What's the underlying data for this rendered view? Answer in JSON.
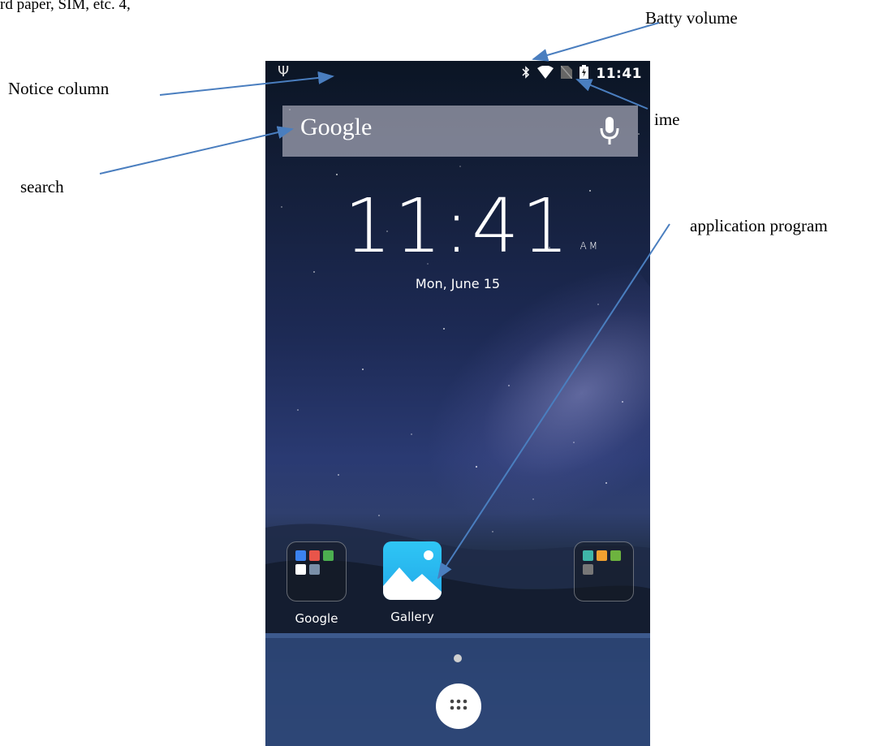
{
  "annotations": {
    "cutoff": "rd paper, SIM, etc. 4,",
    "batty_volume": "Batty volume",
    "notice_column": "Notice column",
    "time": "ime",
    "search": "search",
    "application_program": "application program"
  },
  "status_bar": {
    "left_icon": "usb-icon",
    "icons": [
      "bluetooth-icon",
      "wifi-icon",
      "no-sim-icon",
      "battery-charging-icon"
    ],
    "time": "11:41"
  },
  "search_bar": {
    "text": "Google",
    "icon": "mic-icon"
  },
  "clock_widget": {
    "time": "11:41",
    "ampm": "AM",
    "date": "Mon, June 15"
  },
  "apps": [
    {
      "label": "Google",
      "icon": "google-folder-icon"
    },
    {
      "label": "Gallery",
      "icon": "gallery-icon"
    },
    {
      "label": "",
      "icon": "play-folder-icon"
    }
  ],
  "dock": {
    "icon": "app-drawer-icon"
  },
  "colors": {
    "arrow": "#4a7ebf",
    "search_bg": "#bebecd",
    "gallery": "#2fc6f5"
  }
}
